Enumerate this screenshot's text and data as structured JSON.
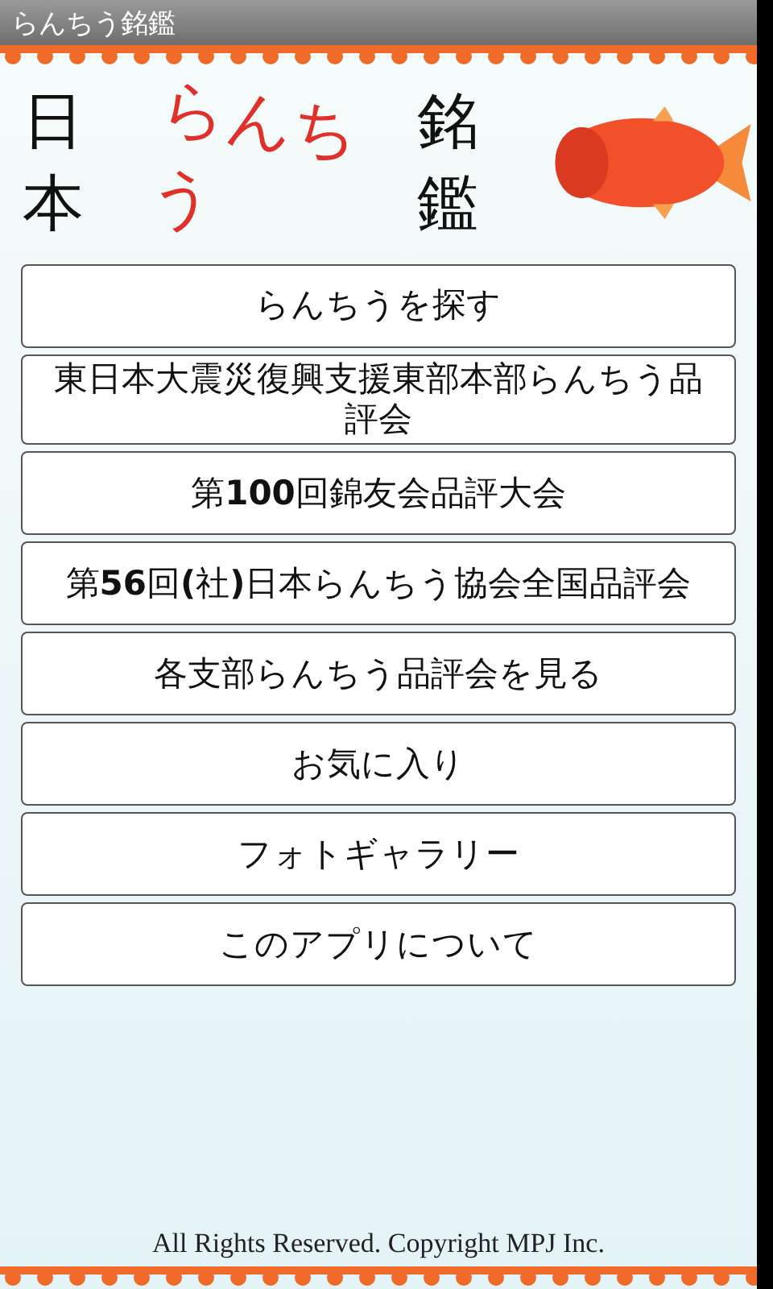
{
  "window": {
    "title": "らんちう銘鑑"
  },
  "logo": {
    "left": "日本",
    "middle": "らんちう",
    "right": "銘鑑"
  },
  "menu": [
    {
      "label": "らんちうを探す"
    },
    {
      "label": "東日本大震災復興支援東部本部らんちう品評会"
    },
    {
      "label": "第**100**回錦友会品評大会"
    },
    {
      "label": "第**56**回**(**社**)**日本らんちう協会全国品評会"
    },
    {
      "label": "各支部らんちう品評会を見る"
    },
    {
      "label": "お気に入り"
    },
    {
      "label": "フォトギャラリー"
    },
    {
      "label": "このアプリについて"
    }
  ],
  "footer": "All Rights Reserved. Copyright MPJ Inc."
}
